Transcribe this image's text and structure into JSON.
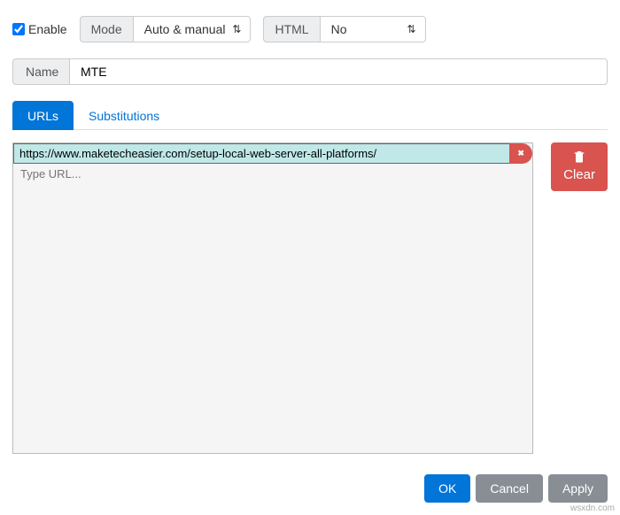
{
  "enable": {
    "label": "Enable",
    "checked": true
  },
  "mode": {
    "label": "Mode",
    "value": "Auto & manual"
  },
  "html": {
    "label": "HTML",
    "value": "No"
  },
  "name": {
    "label": "Name",
    "value": "MTE"
  },
  "tabs": {
    "urls": "URLs",
    "substitutions": "Substitutions"
  },
  "urls": {
    "items": [
      {
        "value": "https://www.maketecheasier.com/setup-local-web-server-all-platforms/"
      }
    ],
    "placeholder": "Type URL...",
    "delete_glyph": "✖"
  },
  "clear": {
    "label": "Clear"
  },
  "footer": {
    "ok": "OK",
    "cancel": "Cancel",
    "apply": "Apply"
  },
  "watermark": "wsxdn.com"
}
